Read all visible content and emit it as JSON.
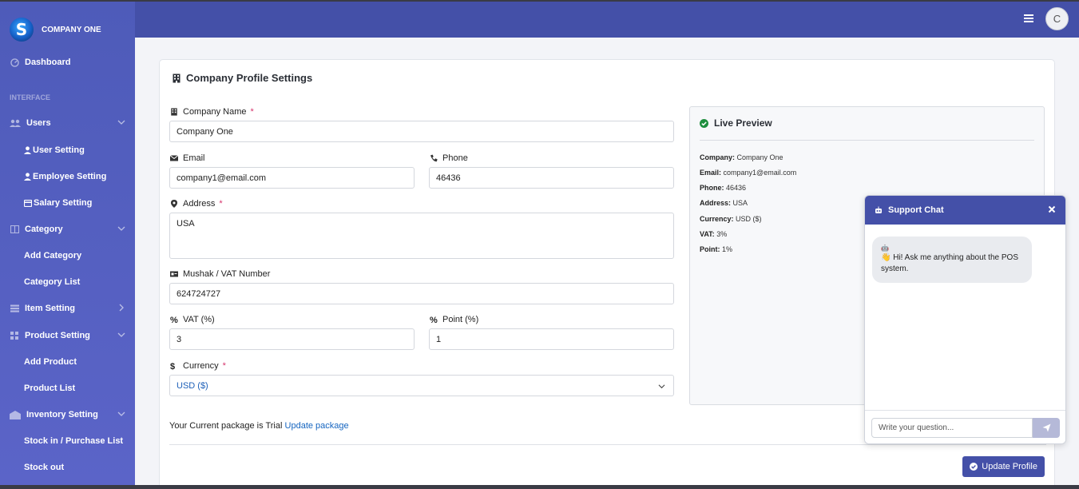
{
  "brand": {
    "name": "COMPANY ONE",
    "logo_letter": "S"
  },
  "sidebar": {
    "dashboard": "Dashboard",
    "heading": "INTERFACE",
    "users": "Users",
    "user_setting": "User Setting",
    "employee_setting": "Employee Setting",
    "salary_setting": "Salary Setting",
    "category": "Category",
    "add_category": "Add Category",
    "category_list": "Category List",
    "item_setting": "Item Setting",
    "product_setting": "Product Setting",
    "add_product": "Add Product",
    "product_list": "Product List",
    "inventory_setting": "Inventory Setting",
    "stock_in": "Stock in / Purchase List",
    "stock_out": "Stock out"
  },
  "topbar": {
    "avatar_letter": "C"
  },
  "form": {
    "title": "Company Profile Settings",
    "company_name_label": "Company Name",
    "company_name": "Company One",
    "email_label": "Email",
    "email": "company1@email.com",
    "phone_label": "Phone",
    "phone": "46436",
    "address_label": "Address",
    "address": "USA",
    "vat_number_label": "Mushak / VAT Number",
    "vat_number": "624724727",
    "vat_label": "VAT (%)",
    "vat": "3",
    "point_label": "Point (%)",
    "point": "1",
    "currency_label": "Currency",
    "currency": "USD ($)",
    "required_mark": "*",
    "package_text": "Your Current package is Trial",
    "update_package": "Update package",
    "submit": "Update Profile"
  },
  "preview": {
    "title": "Live Preview",
    "company_key": "Company:",
    "company_val": "Company One",
    "email_key": "Email:",
    "email_val": "company1@email.com",
    "phone_key": "Phone:",
    "phone_val": "46436",
    "address_key": "Address:",
    "address_val": "USA",
    "currency_key": "Currency:",
    "currency_val": "USD ($)",
    "vat_key": "VAT:",
    "vat_val": "3%",
    "point_key": "Point:",
    "point_val": "1%"
  },
  "chat": {
    "title": "Support Chat",
    "close": "×",
    "robot": "🤖",
    "message": "👋 Hi! Ask me anything about the POS system.",
    "placeholder": "Write your question..."
  },
  "colors": {
    "primary": "#4450a8",
    "sidebar": "#5560c0",
    "link": "#1565c0",
    "success": "#1e8e3e",
    "required": "#d6336c"
  }
}
